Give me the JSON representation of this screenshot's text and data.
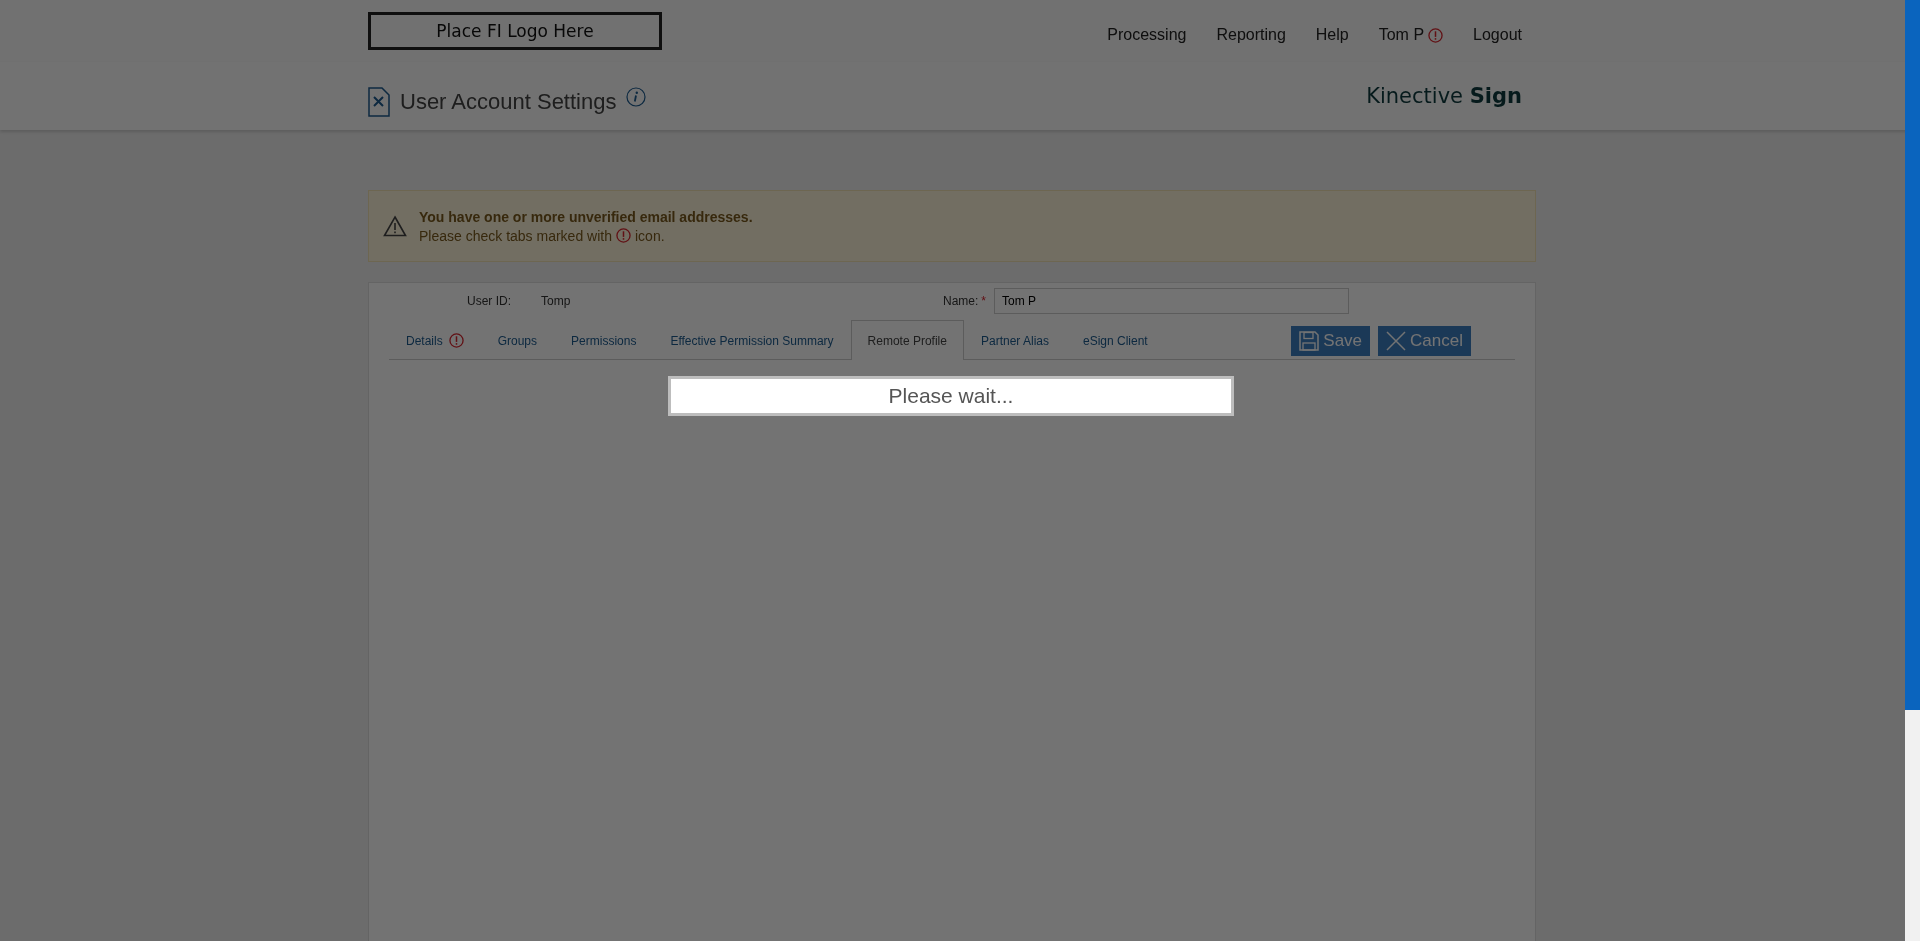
{
  "logo_placeholder": "Place FI Logo Here",
  "nav": [
    {
      "label": "Processing",
      "warning": false
    },
    {
      "label": "Reporting",
      "warning": false
    },
    {
      "label": "Help",
      "warning": false
    },
    {
      "label": "Tom P",
      "warning": true
    },
    {
      "label": "Logout",
      "warning": false
    }
  ],
  "page_title": "User Account Settings",
  "brand": {
    "light": "Kinective",
    "bold": "Sign"
  },
  "alert": {
    "title": "You have one or more unverified email addresses.",
    "text_before": "Please check tabs marked with",
    "text_after": "icon."
  },
  "form": {
    "user_id_label": "User ID:",
    "user_id": "Tomp",
    "name_label": "Name:",
    "required_mark": "*",
    "name_value": "Tom P"
  },
  "tabs": [
    {
      "label": "Details",
      "selected": false,
      "warning": true
    },
    {
      "label": "Groups",
      "selected": false,
      "warning": false
    },
    {
      "label": "Permissions",
      "selected": false,
      "warning": false
    },
    {
      "label": "Effective Permission Summary",
      "selected": false,
      "warning": false
    },
    {
      "label": "Remote Profile",
      "selected": true,
      "warning": false
    },
    {
      "label": "Partner Alias",
      "selected": false,
      "warning": false
    },
    {
      "label": "eSign Client",
      "selected": false,
      "warning": false
    }
  ],
  "buttons": [
    {
      "label": "Save",
      "kind": "save"
    },
    {
      "label": "Cancel",
      "kind": "cancel"
    }
  ],
  "loading": "Please wait..."
}
